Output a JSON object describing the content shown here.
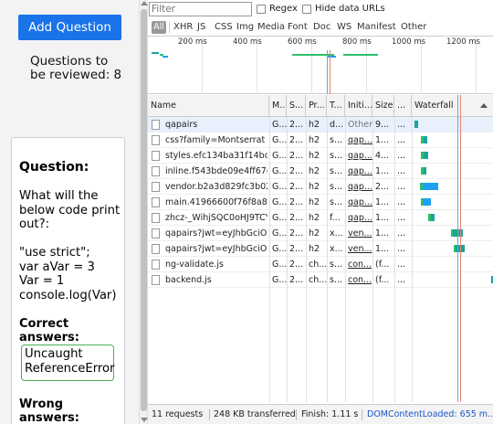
{
  "app": {
    "add_button": "Add Question",
    "review_text": "Questions to be reviewed: 8",
    "question_title": "Question:",
    "question_lines": [
      "What will the below code print out?:",
      "",
      "\"use strict\";",
      "var aVar = 3",
      "Var = 1",
      "console.log(Var)"
    ],
    "correct_title": "Correct answers:",
    "correct_answer": "Uncaught ReferenceError",
    "wrong_title": "Wrong answers:"
  },
  "devtools": {
    "filter_placeholder": "Filter",
    "regex_label": "Regex",
    "hide_data_urls_label": "Hide data URLs",
    "types": [
      "All",
      "XHR",
      "JS",
      "CSS",
      "Img",
      "Media",
      "Font",
      "Doc",
      "WS",
      "Manifest",
      "Other"
    ],
    "overview_ticks": [
      "200 ms",
      "400 ms",
      "600 ms",
      "800 ms",
      "1000 ms",
      "1200 ms"
    ],
    "columns": [
      "Name",
      "M...",
      "S...",
      "Pr...",
      "T...",
      "Initi...",
      "Size",
      "...",
      "Waterfall"
    ],
    "rows": [
      {
        "name": "qapairs",
        "method": "G...",
        "status": "2...",
        "protocol": "h2",
        "type": "d...",
        "initiator": "Other",
        "size": "9...",
        "time": "...",
        "selected": true
      },
      {
        "name": "css?family=Montserrat",
        "method": "G...",
        "status": "2...",
        "protocol": "h2",
        "type": "s...",
        "initiator": "qap...",
        "size": "1...",
        "time": "..."
      },
      {
        "name": "styles.efc134ba31f14bc03...",
        "method": "G...",
        "status": "2...",
        "protocol": "h2",
        "type": "s...",
        "initiator": "qap...",
        "size": "4...",
        "time": "..."
      },
      {
        "name": "inline.f543bde09e4ff67e5...",
        "method": "G...",
        "status": "2...",
        "protocol": "h2",
        "type": "s...",
        "initiator": "qap...",
        "size": "1...",
        "time": "..."
      },
      {
        "name": "vendor.b2a3d829fc3b029...",
        "method": "G...",
        "status": "2...",
        "protocol": "h2",
        "type": "s...",
        "initiator": "qap...",
        "size": "2...",
        "time": "..."
      },
      {
        "name": "main.41966600f76f8a8c7...",
        "method": "G...",
        "status": "2...",
        "protocol": "h2",
        "type": "s...",
        "initiator": "qap...",
        "size": "1...",
        "time": "..."
      },
      {
        "name": "zhcz-_WihjSQC0oHJ9TCY...",
        "method": "G...",
        "status": "2...",
        "protocol": "h2",
        "type": "f...",
        "initiator": "qap...",
        "size": "1...",
        "time": "..."
      },
      {
        "name": "qapairs?jwt=eyJhbGciOiJI...",
        "method": "G...",
        "status": "2...",
        "protocol": "h2",
        "type": "x...",
        "initiator": "ven...",
        "size": "1...",
        "time": "..."
      },
      {
        "name": "qapairs?jwt=eyJhbGciOiJI...",
        "method": "G...",
        "status": "2...",
        "protocol": "h2",
        "type": "x...",
        "initiator": "ven...",
        "size": "1...",
        "time": "..."
      },
      {
        "name": "ng-validate.js",
        "method": "G...",
        "status": "2...",
        "protocol": "ch...",
        "type": "s...",
        "initiator": "con...",
        "size": "(f...",
        "time": "..."
      },
      {
        "name": "backend.js",
        "method": "G...",
        "status": "2...",
        "protocol": "ch...",
        "type": "s...",
        "initiator": "con...",
        "size": "(f...",
        "time": "..."
      }
    ],
    "status": {
      "requests": "11 requests",
      "transferred": "248 KB transferred",
      "finish": "Finish: 1.11 s",
      "dcl": "DOMContentLoaded: 655 m..."
    }
  },
  "colors": {
    "accent": "#1a73e8",
    "dcl_text": "#1a56c8",
    "correct_border": "#4caf50",
    "bar_teal": "#1ba39c",
    "bar_blue": "#1da1f2",
    "bar_green": "#2bbf6b"
  }
}
